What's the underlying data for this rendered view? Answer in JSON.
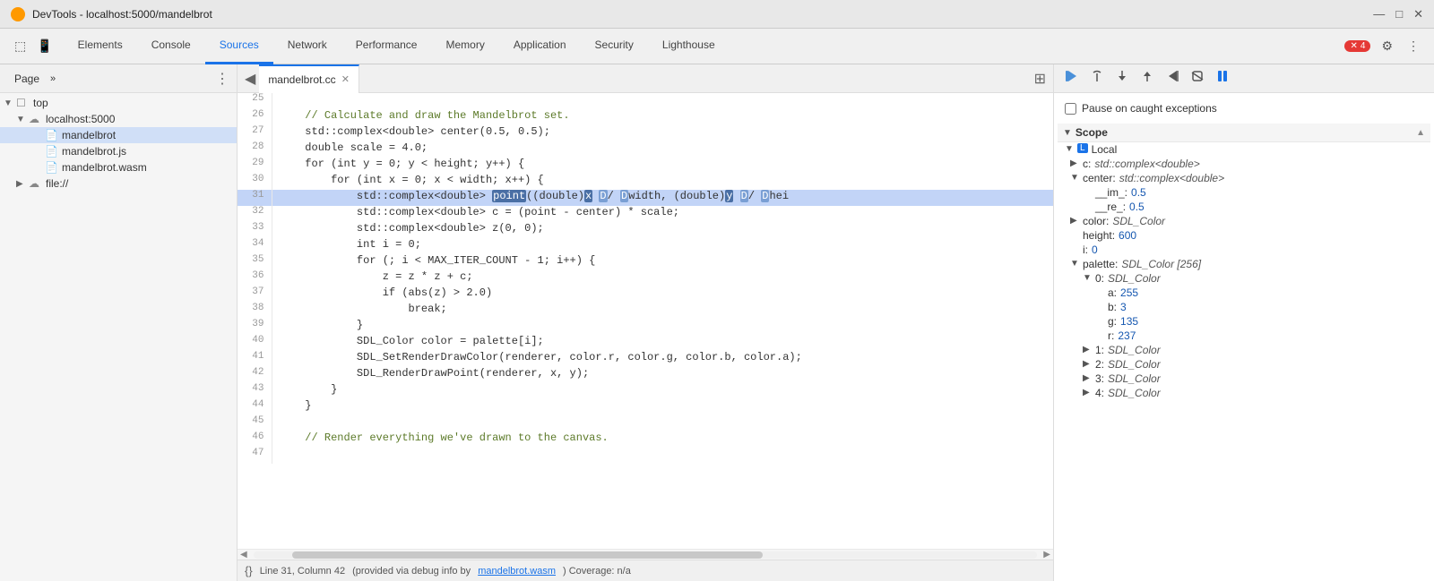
{
  "titleBar": {
    "icon": "🔧",
    "title": "DevTools - localhost:5000/mandelbrot",
    "minimize": "—",
    "maximize": "□",
    "close": "✕"
  },
  "navTabs": [
    {
      "id": "elements",
      "label": "Elements"
    },
    {
      "id": "console",
      "label": "Console"
    },
    {
      "id": "sources",
      "label": "Sources",
      "active": true
    },
    {
      "id": "network",
      "label": "Network"
    },
    {
      "id": "performance",
      "label": "Performance"
    },
    {
      "id": "memory",
      "label": "Memory"
    },
    {
      "id": "application",
      "label": "Application"
    },
    {
      "id": "security",
      "label": "Security"
    },
    {
      "id": "lighthouse",
      "label": "Lighthouse"
    }
  ],
  "navRight": {
    "badgeCount": "4",
    "settingsLabel": "⚙",
    "moreLabel": "⋮"
  },
  "leftPanel": {
    "tab": "Page",
    "moreIcon": "»",
    "dotsIcon": "⋮",
    "tree": [
      {
        "id": "top",
        "label": "top",
        "indent": 0,
        "type": "expanded-folder",
        "icon": "▼"
      },
      {
        "id": "localhost",
        "label": "localhost:5000",
        "indent": 1,
        "type": "cloud-expanded",
        "icon": "▼"
      },
      {
        "id": "mandelbrot",
        "label": "mandelbrot",
        "indent": 2,
        "type": "file-cc",
        "selected": true
      },
      {
        "id": "mandelbrot-js",
        "label": "mandelbrot.js",
        "indent": 2,
        "type": "file-js"
      },
      {
        "id": "mandelbrot-wasm",
        "label": "mandelbrot.wasm",
        "indent": 2,
        "type": "file-wasm"
      },
      {
        "id": "file",
        "label": "file://",
        "indent": 1,
        "type": "cloud-collapsed",
        "icon": "▶"
      }
    ]
  },
  "fileTab": {
    "navIcon": "◀",
    "filename": "mandelbrot.cc",
    "closeIcon": "✕",
    "expandIcon": "⊞"
  },
  "codeLines": [
    {
      "num": 25,
      "content": ""
    },
    {
      "num": 26,
      "content": "    // Calculate and draw the Mandelbrot set.",
      "type": "comment"
    },
    {
      "num": 27,
      "content": "    std::complex<double> center(0.5, 0.5);"
    },
    {
      "num": 28,
      "content": "    double scale = 4.0;"
    },
    {
      "num": 29,
      "content": "    for (int y = 0; y < height; y++) {"
    },
    {
      "num": 30,
      "content": "        for (int x = 0; x < width; x++) {"
    },
    {
      "num": 31,
      "content": "            std::complex<double> point((double)x D/ Dwidth, (double)Dy D/ Dhei",
      "type": "current"
    },
    {
      "num": 32,
      "content": "            std::complex<double> c = (point - center) * scale;"
    },
    {
      "num": 33,
      "content": "            std::complex<double> z(0, 0);"
    },
    {
      "num": 34,
      "content": "            int i = 0;"
    },
    {
      "num": 35,
      "content": "            for (; i < MAX_ITER_COUNT - 1; i++) {"
    },
    {
      "num": 36,
      "content": "                z = z * z + c;"
    },
    {
      "num": 37,
      "content": "                if (abs(z) > 2.0)"
    },
    {
      "num": 38,
      "content": "                    break;"
    },
    {
      "num": 39,
      "content": "            }"
    },
    {
      "num": 40,
      "content": "            SDL_Color color = palette[i];"
    },
    {
      "num": 41,
      "content": "            SDL_SetRenderDrawColor(renderer, color.r, color.g, color.b, color.a);"
    },
    {
      "num": 42,
      "content": "            SDL_RenderDrawPoint(renderer, x, y);"
    },
    {
      "num": 43,
      "content": "        }"
    },
    {
      "num": 44,
      "content": "    }"
    },
    {
      "num": 45,
      "content": ""
    },
    {
      "num": 46,
      "content": "    // Render everything we've drawn to the canvas.",
      "type": "comment"
    },
    {
      "num": 47,
      "content": ""
    }
  ],
  "statusBar": {
    "icon": "{}",
    "position": "Line 31, Column 42",
    "separator": "|",
    "info": "(provided via debug info by",
    "link": "mandelbrot.wasm",
    "info2": ") Coverage: n/a"
  },
  "debugToolbar": {
    "resume": "▶",
    "stepOver": "↺",
    "stepInto": "↓",
    "stepOut": "↑",
    "stepBack": "⇥",
    "deactivate": "⊘",
    "pause": "⏸"
  },
  "pauseCaught": {
    "label": "Pause on caught exceptions"
  },
  "scopePanel": {
    "header": "Scope",
    "collapseIcon": "▲",
    "local": {
      "label": "Local",
      "icon": "L",
      "items": [
        {
          "key": "▶ c:",
          "value": "std::complex<double>",
          "valueType": "type",
          "indent": 1
        },
        {
          "key": "▼ center:",
          "value": "std::complex<double>",
          "valueType": "type",
          "indent": 1
        },
        {
          "key": "__im_:",
          "value": "0.5",
          "valueType": "num",
          "indent": 2
        },
        {
          "key": "__re_:",
          "value": "0.5",
          "valueType": "num",
          "indent": 2
        },
        {
          "key": "▶ color:",
          "value": "SDL_Color",
          "valueType": "type",
          "indent": 1
        },
        {
          "key": "height:",
          "value": "600",
          "valueType": "num",
          "indent": 1
        },
        {
          "key": "i:",
          "value": "0",
          "valueType": "num",
          "indent": 1
        },
        {
          "key": "▼ palette:",
          "value": "SDL_Color [256]",
          "valueType": "type",
          "indent": 1
        },
        {
          "key": "▼ 0:",
          "value": "SDL_Color",
          "valueType": "type",
          "indent": 2
        },
        {
          "key": "a:",
          "value": "255",
          "valueType": "num",
          "indent": 3
        },
        {
          "key": "b:",
          "value": "3",
          "valueType": "num",
          "indent": 3
        },
        {
          "key": "g:",
          "value": "135",
          "valueType": "num",
          "indent": 3
        },
        {
          "key": "r:",
          "value": "237",
          "valueType": "num",
          "indent": 3
        },
        {
          "key": "▶ 1:",
          "value": "SDL_Color",
          "valueType": "type",
          "indent": 2
        },
        {
          "key": "▶ 2:",
          "value": "SDL_Color",
          "valueType": "type",
          "indent": 2
        },
        {
          "key": "▶ 3:",
          "value": "SDL_Color",
          "valueType": "type",
          "indent": 2
        },
        {
          "key": "▶ 4:",
          "value": "SDL_Color",
          "valueType": "type",
          "indent": 2
        }
      ]
    }
  }
}
